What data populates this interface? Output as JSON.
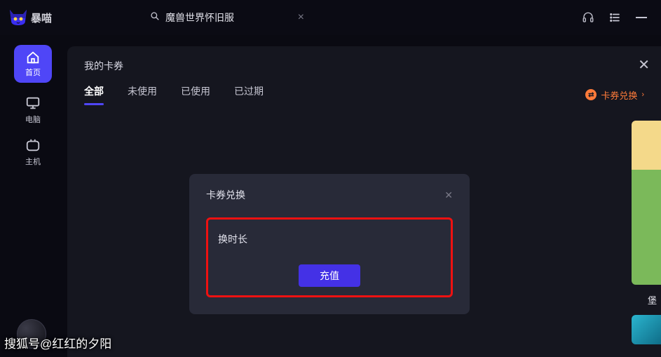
{
  "app": {
    "name": "暴喵"
  },
  "search": {
    "value": "魔兽世界怀旧服"
  },
  "sidebar": {
    "items": [
      {
        "label": "首页"
      },
      {
        "label": "电脑"
      },
      {
        "label": "主机"
      }
    ]
  },
  "coupon_modal": {
    "title": "我的卡券",
    "tabs": [
      "全部",
      "未使用",
      "已使用",
      "已过期"
    ],
    "redeem_label": "卡券兑换",
    "redeem_arrow": "›"
  },
  "redeem_dialog": {
    "title": "卡券兑换",
    "input_placeholder": "换时长",
    "charge_label": "充值"
  },
  "right_caption": "堡",
  "redeem_icon_glyph": "⇄",
  "watermark": "搜狐号@红红的夕阳"
}
